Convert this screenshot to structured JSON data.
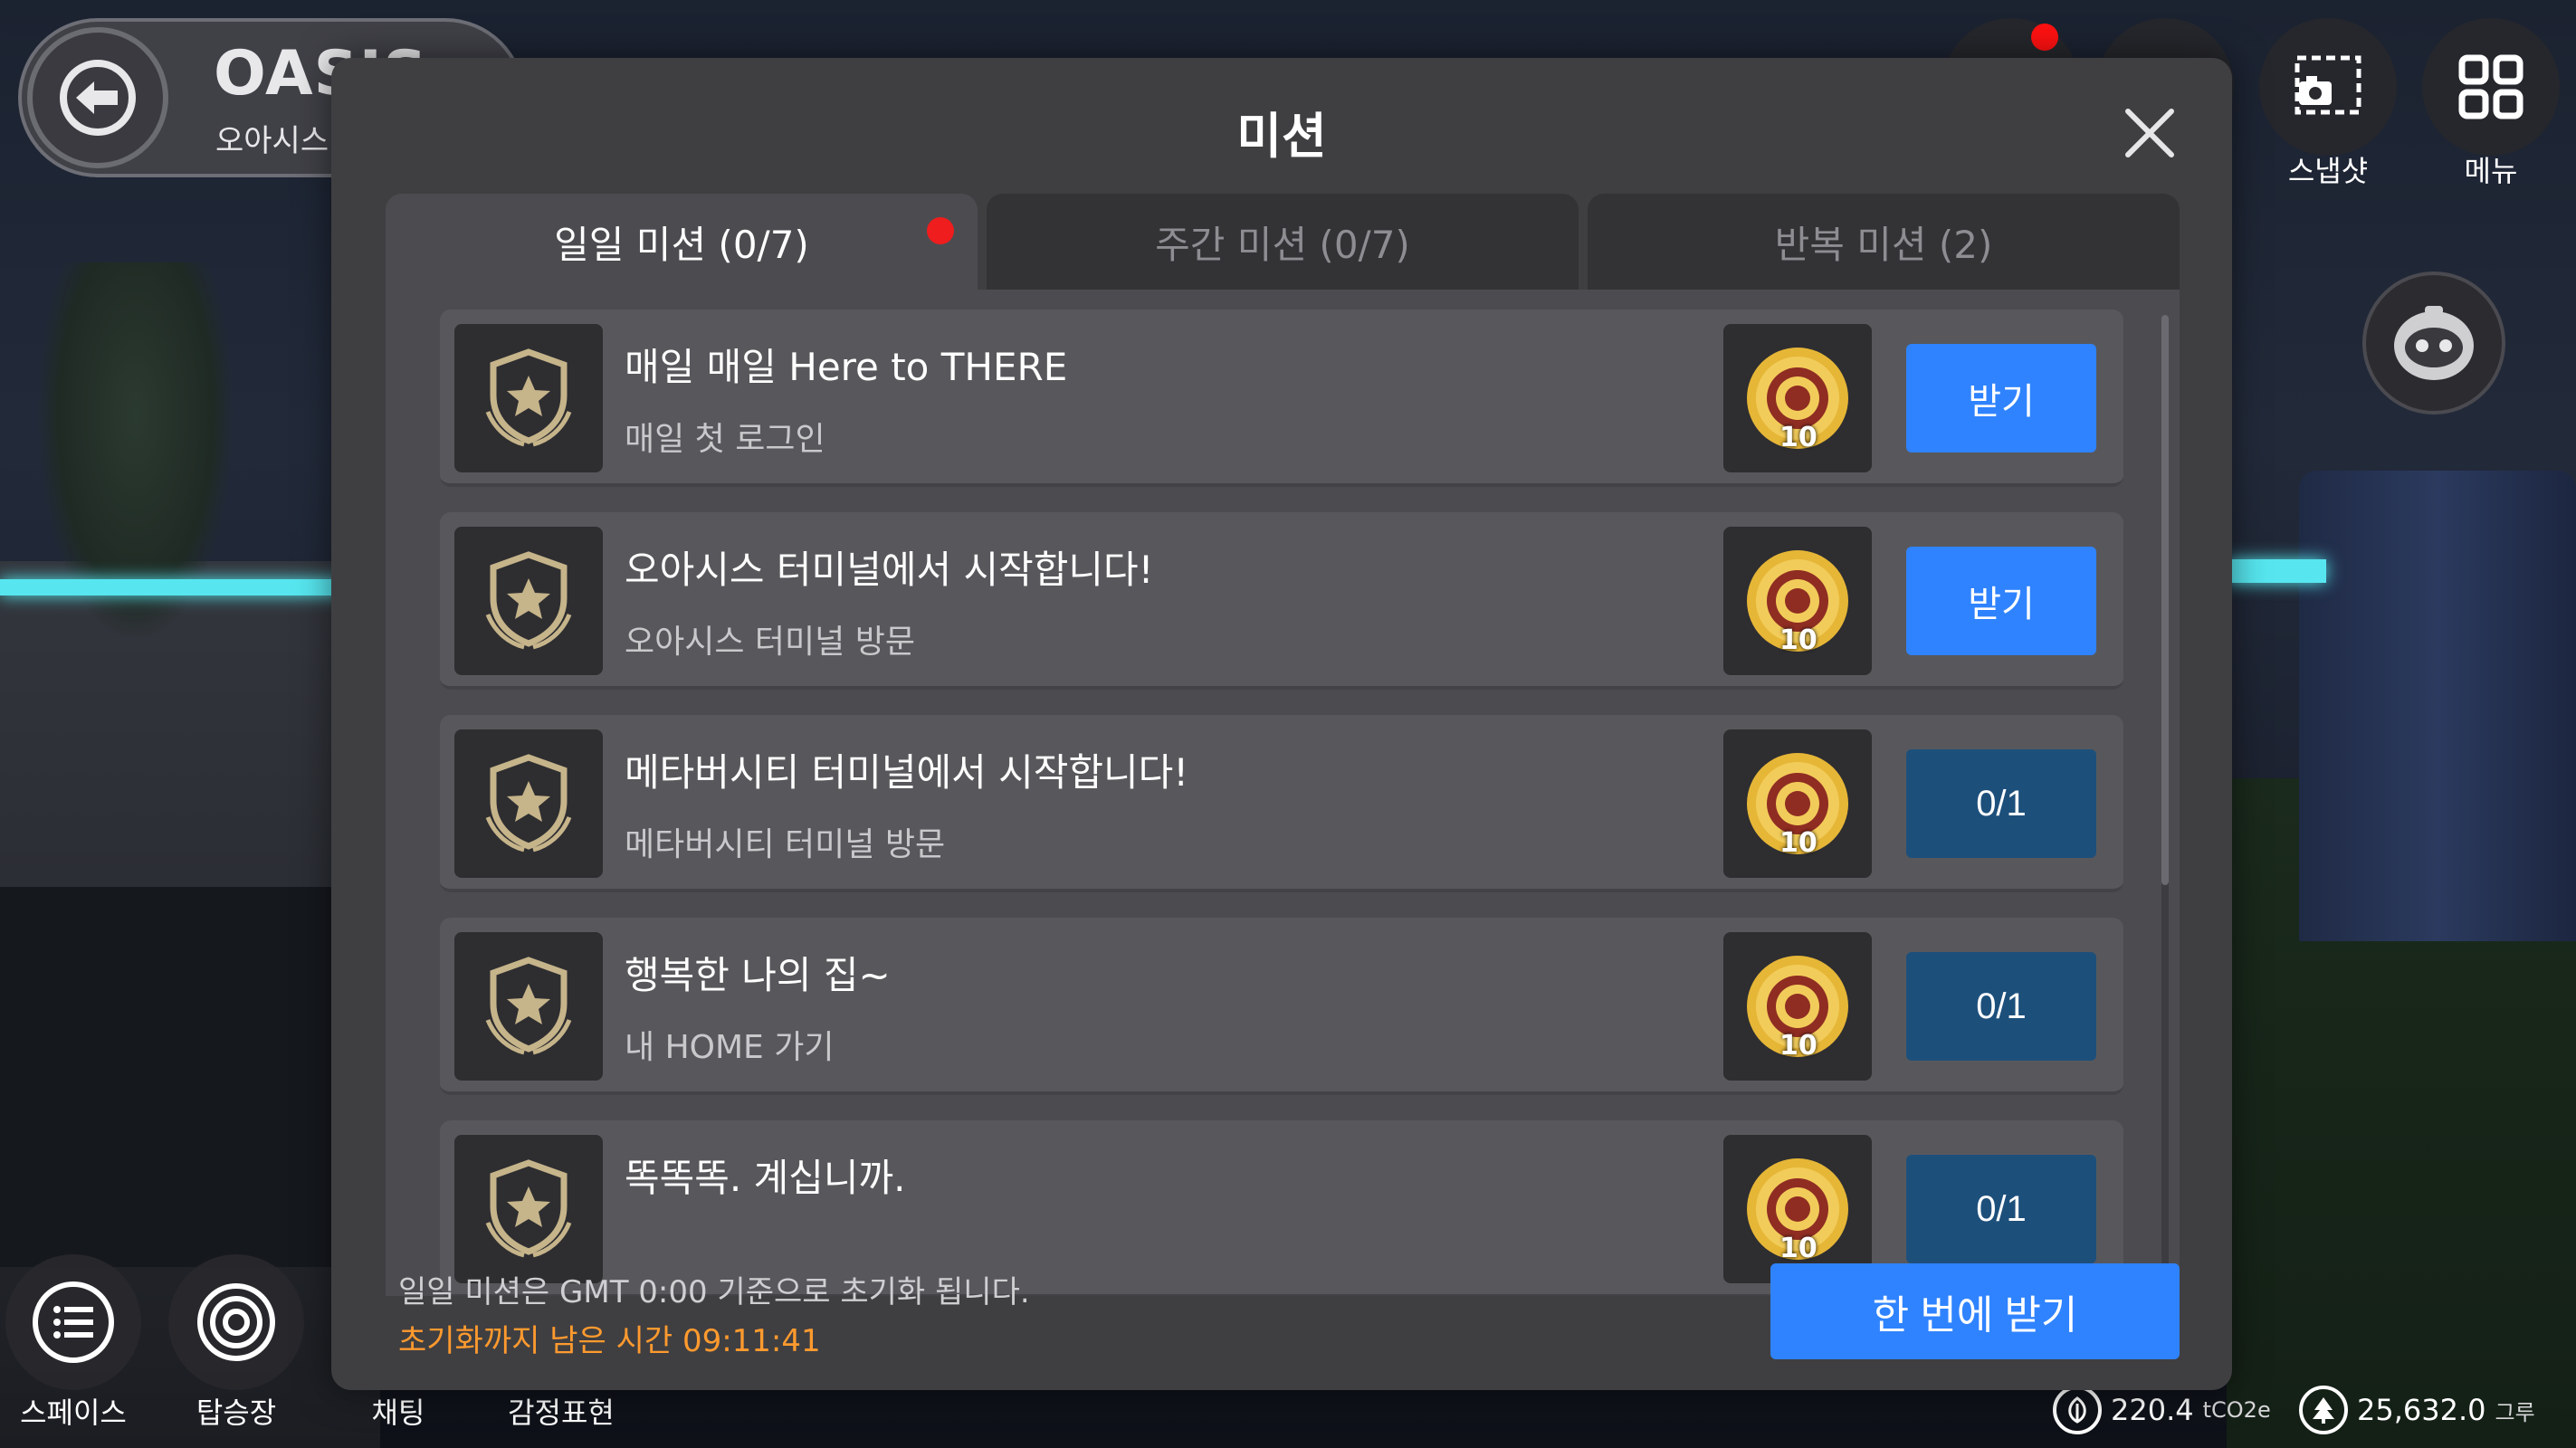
{
  "space": {
    "name": "OASIS",
    "subtitle": "오아시스 터미널"
  },
  "top_right": {
    "snapshot_label": "스냅샷",
    "menu_label": "메뉴"
  },
  "bottom_nav": [
    {
      "label": "스페이스"
    },
    {
      "label": "탑승장"
    },
    {
      "label": "채팅"
    },
    {
      "label": "감정표현"
    }
  ],
  "stats": {
    "carbon_value": "220.4",
    "carbon_unit": "tCO2e",
    "tree_value": "25,632.0",
    "tree_unit": "그루"
  },
  "modal": {
    "title": "미션",
    "tabs": [
      {
        "label": "일일 미션 (0/7)",
        "active": true,
        "has_dot": true
      },
      {
        "label": "주간 미션 (0/7)",
        "active": false,
        "has_dot": false
      },
      {
        "label": "반복 미션 (2)",
        "active": false,
        "has_dot": false
      }
    ],
    "missions": [
      {
        "title": "매일 매일 Here to THERE",
        "desc": "매일 첫 로그인",
        "reward": "10",
        "action": "받기",
        "claimable": true
      },
      {
        "title": "오아시스 터미널에서 시작합니다!",
        "desc": "오아시스 터미널 방문",
        "reward": "10",
        "action": "받기",
        "claimable": true
      },
      {
        "title": "메타버시티 터미널에서 시작합니다!",
        "desc": "메타버시티 터미널 방문",
        "reward": "10",
        "action": "0/1",
        "claimable": false
      },
      {
        "title": "행복한 나의 집~",
        "desc": "내 HOME 가기",
        "reward": "10",
        "action": "0/1",
        "claimable": false
      },
      {
        "title": "똑똑똑. 계십니까.",
        "desc": "",
        "reward": "10",
        "action": "0/1",
        "claimable": false
      }
    ],
    "footer_note": "일일 미션은 GMT 0:00 기준으로 초기화 됩니다.",
    "footer_timer": "초기화까지 남은 시간  09:11:41",
    "claim_all_label": "한 번에 받기"
  },
  "colors": {
    "claim_button": "#2f83ff",
    "progress_button": "#1d4f7b",
    "timer_text": "#ff9a2e",
    "notification_dot": "#ef1d1d"
  }
}
